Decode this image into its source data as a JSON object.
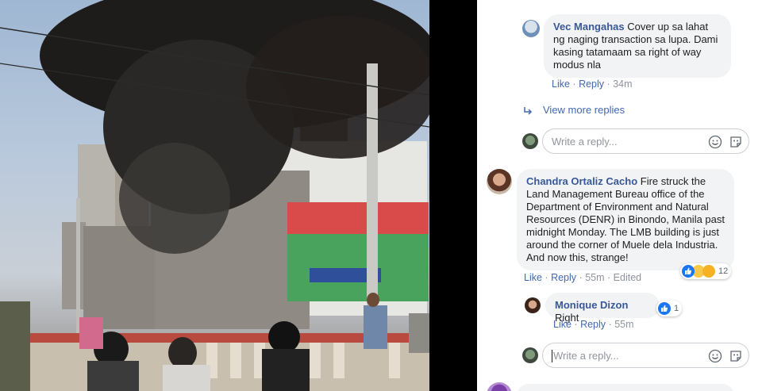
{
  "comments": [
    {
      "name": "Vec Mangahas",
      "text": "Cover up sa lahat ng naging transaction sa lupa. Dami kasing tatamaam sa right of way modus nla",
      "like": "Like",
      "reply": "Reply",
      "time": "34m"
    },
    {
      "name": "Chandra Ortaliz Cacho",
      "text": "Fire struck the Land Management Bureau office of the Department of Environment and Natural Resources (DENR) in Binondo, Manila past midnight Monday. The LMB building is just around the corner of Muele dela Industria. And now this, strange!",
      "like": "Like",
      "reply": "Reply",
      "time": "55m",
      "edited": "Edited",
      "reaction_count": "12"
    },
    {
      "name": "Monique Dizon",
      "text": "Right",
      "like": "Like",
      "reply": "Reply",
      "time": "55m",
      "reaction_count": "1"
    }
  ],
  "view_more_replies": "View more replies",
  "reply_placeholder": "Write a reply...",
  "separator": "·",
  "icons": {
    "reply_arrow": "reply-arrow-icon",
    "emoji": "emoji-icon",
    "sticker": "sticker-icon",
    "like_reaction": "like-reaction-icon"
  },
  "colors": {
    "link": "#385898",
    "meta_link": "#4267b2",
    "bubble": "#f2f3f5",
    "like": "#1877f2"
  }
}
